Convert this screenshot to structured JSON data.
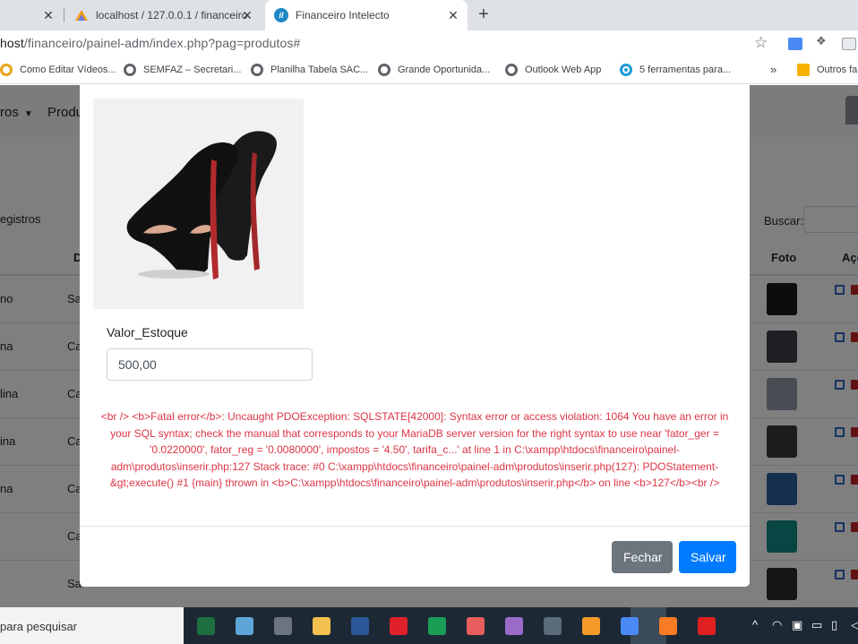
{
  "browser": {
    "tabs": [
      {
        "title": ""
      },
      {
        "title": "localhost / 127.0.0.1 / financeiro"
      },
      {
        "title": "Financeiro Intelecto",
        "favicon_text": "iI"
      }
    ],
    "url_host": "host",
    "url_path": "/financeiro/painel-adm/index.php?pag=produtos#",
    "bookmarks": [
      "Como Editar Vídeos...",
      "SEMFAZ – Secretari...",
      "Planilha Tabela SAC...",
      "Grande Oportunida...",
      "Outlook Web App",
      "5 ferramentas para...",
      "Outros fa"
    ],
    "bookmarks_more": "»"
  },
  "page": {
    "nav": {
      "item1": "ros",
      "item2": "Produ"
    },
    "table": {
      "length_label": "egistros",
      "search_label": "Buscar:",
      "headers": {
        "col2": "D",
        "foto": "Foto",
        "acoes": "Açõ"
      },
      "rows": [
        {
          "c1": "no",
          "c2": "Sa",
          "thumb_color": "#1b1b1b"
        },
        {
          "c1": "na",
          "c2": "Ca",
          "thumb_color": "#3c3f45"
        },
        {
          "c1": "lina",
          "c2": "Ca",
          "thumb_color": "#8f9aa6"
        },
        {
          "c1": "ina",
          "c2": "Ca",
          "thumb_color": "#3b3a39"
        },
        {
          "c1": "na",
          "c2": "Ca",
          "thumb_color": "#2a5f9e"
        },
        {
          "c1": "",
          "c2": "Ca",
          "thumb_color": "#138a84"
        },
        {
          "c1": "",
          "c2": "Sa",
          "thumb_color": "#2b2b2b"
        }
      ]
    }
  },
  "modal": {
    "field_label": "Valor_Estoque",
    "field_value": "500,00",
    "error": "<br /> <b>Fatal error</b>: Uncaught PDOException: SQLSTATE[42000]: Syntax error or access violation: 1064 You have an error in your SQL syntax; check the manual that corresponds to your MariaDB server version for the right syntax to use near 'fator_ger = '0.0220000', fator_reg = '0.0080000', impostos = '4.50', tarifa_c...' at line 1 in C:\\xampp\\htdocs\\financeiro\\painel-adm\\produtos\\inserir.php:127 Stack trace: #0 C:\\xampp\\htdocs\\financeiro\\painel-adm\\produtos\\inserir.php(127): PDOStatement-&gt;execute() #1 {main} thrown in <b>C:\\xampp\\htdocs\\financeiro\\painel-adm\\produtos\\inserir.php</b> on line <b>127</b><br />",
    "buttons": {
      "close": "Fechar",
      "save": "Salvar"
    }
  },
  "taskbar": {
    "search_placeholder": "para pesquisar",
    "apps": [
      {
        "name": "excel",
        "color": "#1d6f42"
      },
      {
        "name": "notepad",
        "color": "#5ea6d8"
      },
      {
        "name": "calculator",
        "color": "#6b7480"
      },
      {
        "name": "file-explorer",
        "color": "#f2c14e"
      },
      {
        "name": "word",
        "color": "#2b579a"
      },
      {
        "name": "opera",
        "color": "#e0202b"
      },
      {
        "name": "sheets",
        "color": "#1a9e55"
      },
      {
        "name": "app-circle",
        "color": "#e85d5d"
      },
      {
        "name": "paint",
        "color": "#9a6cc8"
      },
      {
        "name": "camera",
        "color": "#5a6b7b"
      },
      {
        "name": "sublime",
        "color": "#f49b2a"
      },
      {
        "name": "chrome",
        "color": "#4a8af4"
      },
      {
        "name": "xampp",
        "color": "#fb7a24"
      },
      {
        "name": "acrobat",
        "color": "#e02020"
      }
    ]
  }
}
